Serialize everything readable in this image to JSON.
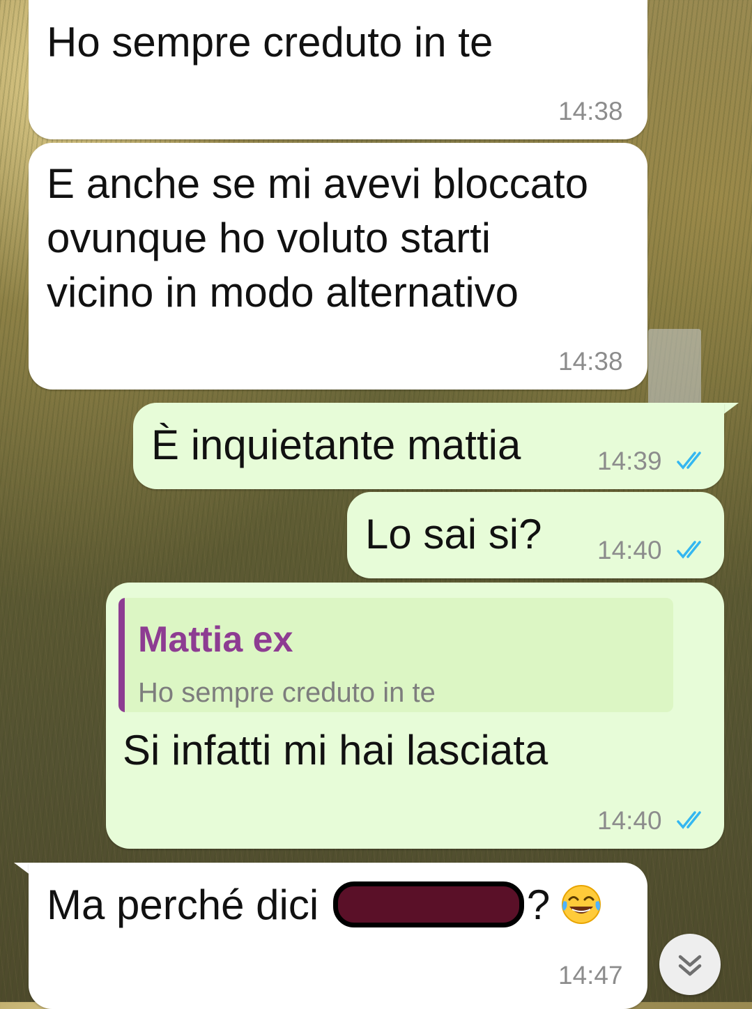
{
  "chat": {
    "contact_name": "Mattia ex",
    "messages": [
      {
        "direction": "in",
        "text": "Ho sempre creduto in te",
        "time": "14:38"
      },
      {
        "direction": "in",
        "text": "E anche se mi avevi bloccato\novunque ho voluto starti\nvicino in modo alternativo",
        "time": "14:38"
      },
      {
        "direction": "out",
        "text": "È inquietante mattia",
        "time": "14:39",
        "status": "read"
      },
      {
        "direction": "out",
        "text": "Lo sai si?",
        "time": "14:40",
        "status": "read"
      },
      {
        "direction": "out",
        "reply_to": {
          "author": "Mattia ex",
          "text": "Ho sempre creduto in te"
        },
        "text": "Si infatti mi hai lasciata",
        "time": "14:40",
        "status": "read"
      },
      {
        "direction": "in",
        "text_before": "Ma perché dici ",
        "text_after": "?",
        "redacted": true,
        "emoji": "face-with-tears-of-joy",
        "time": "14:47"
      }
    ]
  },
  "colors": {
    "incoming_bubble": "#ffffff",
    "outgoing_bubble": "#e7fcd8",
    "read_ticks": "#34b7f1",
    "quote_accent": "#8d3c92",
    "timestamp": "#8c8c8c"
  },
  "icons": {
    "read_receipt": "double-check-icon",
    "scroll_down": "double-chevron-down-icon"
  }
}
